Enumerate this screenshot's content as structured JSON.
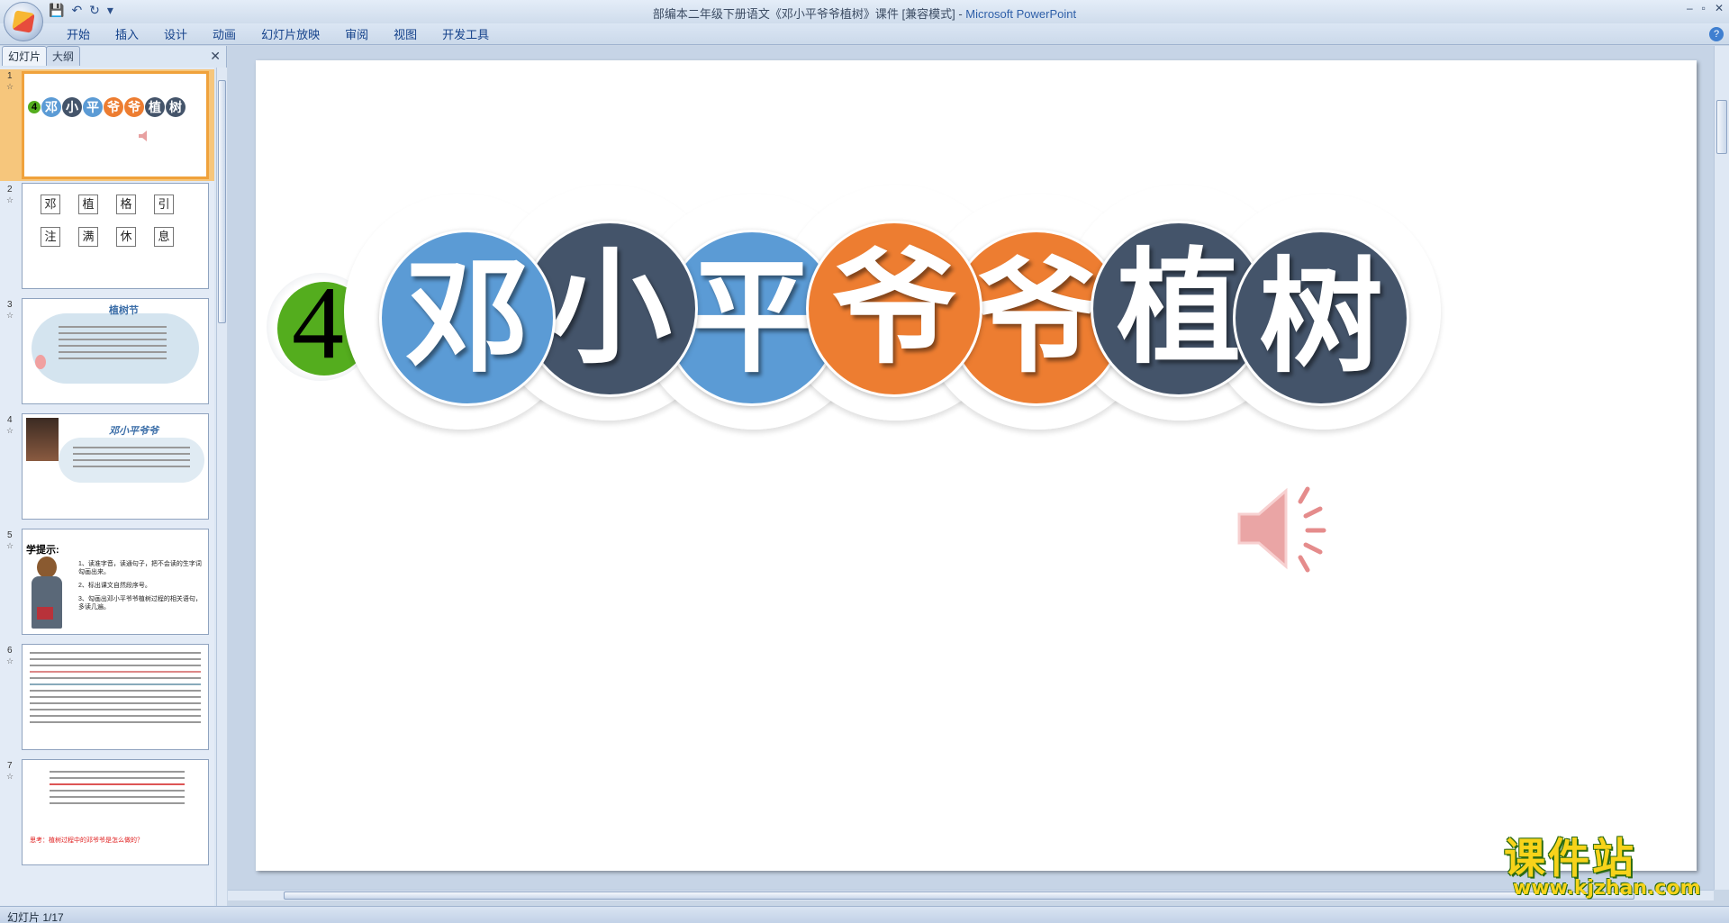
{
  "window": {
    "title_doc": "部编本二年级下册语文《邓小平爷爷植树》课件 [兼容模式] - ",
    "title_app": "Microsoft PowerPoint",
    "controls": [
      "–",
      "▫",
      "✕"
    ]
  },
  "quick_access": {
    "save": "💾",
    "undo": "↶",
    "redo": "↻",
    "more": "▾"
  },
  "ribbon": {
    "tabs": [
      "开始",
      "插入",
      "设计",
      "动画",
      "幻灯片放映",
      "审阅",
      "视图",
      "开发工具"
    ],
    "help": "?"
  },
  "panel": {
    "tabs": [
      "幻灯片",
      "大纲"
    ],
    "close": "✕"
  },
  "thumbnails": [
    {
      "num": "1",
      "anim": "☆"
    },
    {
      "num": "2",
      "anim": "☆",
      "chars": [
        "邓",
        "植",
        "格",
        "引",
        "注",
        "满",
        "休",
        "息"
      ]
    },
    {
      "num": "3",
      "anim": "☆",
      "title": "植树节"
    },
    {
      "num": "4",
      "anim": "☆",
      "title": "邓小平爷爷"
    },
    {
      "num": "5",
      "anim": "☆",
      "title": "学提示:",
      "items": [
        "1、读准字音，读通句子，把不会读的生字词勾画出来。",
        "2、标出课文自然段序号。",
        "3、勾画出邓小平爷爷植树过程的相关语句，多读几遍。"
      ]
    },
    {
      "num": "6",
      "anim": "☆"
    },
    {
      "num": "7",
      "anim": "☆",
      "footer": "思考：植树过程中的邓爷爷是怎么做的？"
    }
  ],
  "slide": {
    "number": "4",
    "title_chars": [
      {
        "char": "邓",
        "color": "#5b9bd5"
      },
      {
        "char": "小",
        "color": "#44546a"
      },
      {
        "char": "平",
        "color": "#5b9bd5"
      },
      {
        "char": "爷",
        "color": "#ed7d31"
      },
      {
        "char": "爷",
        "color": "#ed7d31"
      },
      {
        "char": "植",
        "color": "#44546a"
      },
      {
        "char": "树",
        "color": "#44546a"
      }
    ],
    "speaker_icon": "speaker-icon"
  },
  "status": {
    "slide_info": "幻灯片 1/17"
  },
  "watermark": {
    "top": "课件站",
    "bottom": "www.kjzhan.com"
  }
}
